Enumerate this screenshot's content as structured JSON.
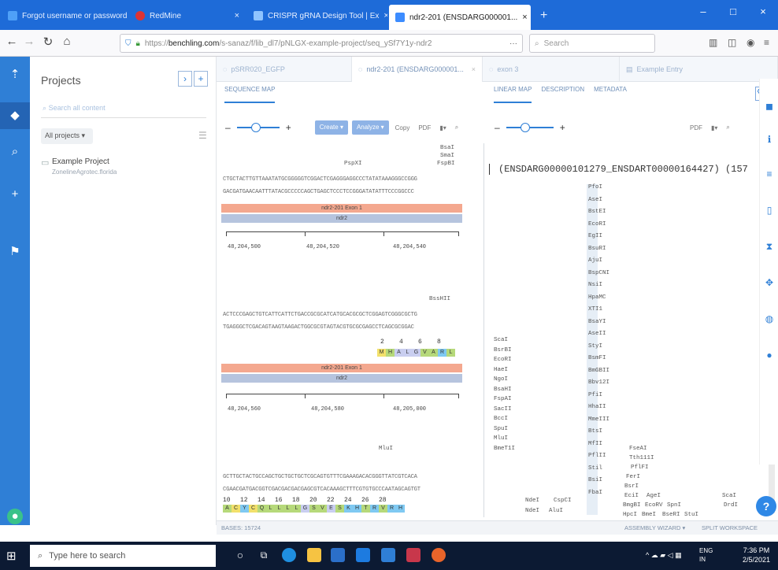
{
  "browser": {
    "tabs": [
      {
        "label": "Forgot username or password",
        "color": "#4fa0f7"
      },
      {
        "label": "RedMine",
        "color": "#d33"
      },
      {
        "label": "CRISPR gRNA Design Tool | Ex",
        "color": "#1e6bd8"
      },
      {
        "label": "ndr2-201 (ENSDARG000001...",
        "color": "#3c8cff"
      }
    ],
    "new_tab": "+",
    "window_controls": [
      "–",
      "□",
      "×"
    ],
    "url_prefix": "https://",
    "url_domain": "benchling.com",
    "url_rest": "/s-sanaz/f/lib_dl7/pNLGX-example-project/seq_ySf7Y1y-ndr2",
    "url_more": "···",
    "search_placeholder": "Search"
  },
  "rail": {
    "icons": [
      "pin",
      "box",
      "search",
      "plus",
      "flag"
    ]
  },
  "projects": {
    "title": "Projects",
    "collapse_btn": "›",
    "add_btn": "+",
    "search_placeholder": "Search all content",
    "filter": "All projects ▾",
    "items": [
      {
        "name": "Example Project",
        "subtitle": "ZonelineAgrotec.florida"
      }
    ]
  },
  "doc_tabs": [
    {
      "label": "pSRR020_EGFP"
    },
    {
      "label": "ndr2-201 (ENSDARG000001..."
    },
    {
      "label": "exon 3"
    },
    {
      "label": "Example Entry"
    }
  ],
  "left_panel": {
    "tab": "SEQUENCE MAP",
    "create_btn": "Create ▾",
    "analyze_btn": "Analyze ▾",
    "copy": "Copy",
    "pdf": "PDF",
    "blocks": [
      {
        "enzymes": [
          "BsaI",
          "SmaI",
          "PspXI",
          "FspBI"
        ],
        "top": "CTGCTACTTGTTAAATATGCGGGGGTCGGACTCGAGGGAGGCCCTATATAAAGGGCCGGG",
        "bottom": "GACGATGAACAATTTATACGCCCCCAGCTGAGCTCCCTCCGGGATATATTTCCCGGCCC",
        "feature": "ndr2-201 Exon 1",
        "gene": "ndr2",
        "ticks": [
          "48,204,500",
          "48,204,520",
          "48,204,540"
        ]
      },
      {
        "enzymes": [
          "BssHII"
        ],
        "top": "ACTCCCGAGCTGTCATTCATTCTGACCGCGCATCATGCACGCGCTCGGAGTCGGGCGCTG",
        "bottom": "TGAGGGCTCGACAGTAAGTAAGACTGGCGCGTAGTACGTGCGCGAGCCTCAGCGCGGAC",
        "aa_numbers": [
          "2",
          "4",
          "6",
          "8"
        ],
        "aa": [
          "M",
          "H",
          "A",
          "L",
          "G",
          "V",
          "A",
          "R",
          "L"
        ],
        "aa_colors": [
          "#f2e06b",
          "#b6d97a",
          "#c9cef0",
          "#c9cef0",
          "#c9cef0",
          "#b6d97a",
          "#b6d97a",
          "#7fc9f2",
          "#b6d97a"
        ],
        "feature": "ndr2-201 Exon 1",
        "gene": "ndr2",
        "ticks": [
          "48,204,560",
          "48,204,580",
          "48,205,000"
        ]
      },
      {
        "enzymes": [
          "MluI"
        ],
        "top": "GCTTGCTACTGCCAGCTGCTGCTGCTCGCAGTGTTTCGAAAGACACGGGTTATCGTCACA",
        "bottom": "CGAACGATGACGGTCGACGACGACGAGCGTCACAAAGCTTTCGTGTGCCCAATAGCAGTGT",
        "aa_numbers": [
          "10",
          "12",
          "14",
          "16",
          "18",
          "20",
          "22",
          "24",
          "26",
          "28"
        ],
        "aa": [
          "A",
          "C",
          "Y",
          "C",
          "Q",
          "L",
          "L",
          "L",
          "L",
          "G",
          "S",
          "V",
          "E",
          "S",
          "K",
          "H",
          "T",
          "R",
          "V",
          "R",
          "H"
        ],
        "aa_colors": [
          "#b6d97a",
          "#f2e06b",
          "#7fc9f2",
          "#f2e06b",
          "#b6d97a",
          "#b6d97a",
          "#b6d97a",
          "#b6d97a",
          "#b6d97a",
          "#c9cef0",
          "#b6d97a",
          "#b6d97a",
          "#c9cef0",
          "#b6d97a",
          "#7fc9f2",
          "#7fc9f2",
          "#b6d97a",
          "#7fc9f2",
          "#b6d97a",
          "#7fc9f2",
          "#7fc9f2"
        ]
      }
    ],
    "status": "BASES: 15724"
  },
  "right_panel": {
    "tabs": [
      "LINEAR MAP",
      "DESCRIPTION",
      "METADATA"
    ],
    "pdf": "PDF",
    "title": "(ENSDARG00000101279_ENSDART00000164427) (157",
    "center_enzymes": [
      "PfoI",
      "AseI",
      "BstEI",
      "EcoRI",
      "EgII",
      "BsuRI",
      "AjuI",
      "BspCNI",
      "NsiI",
      "HpaMC",
      "XTI1",
      "BsaYI",
      "AseII",
      "StyI",
      "BsmFI",
      "BmGBII",
      "Bbv12I",
      "PfiI",
      "HhaII",
      "MmeIII",
      "BtsI",
      "MfII",
      "PflII",
      "Stil",
      "BsiI",
      "FbaI"
    ],
    "left_enzymes": [
      "ScaI",
      "BsrBI",
      "EcoRI",
      "HaeI",
      "NgoI",
      "BsaHI",
      "FspAI",
      "SacII",
      "BccI",
      "SpuI",
      "MluI",
      "BmeT1I"
    ],
    "bottom_row1": [
      "NdeI",
      "CspCI",
      "AgeI",
      "ScaI"
    ],
    "bottom_row2": [
      "NdeI",
      "AluI",
      "EcoRV",
      "SpnI",
      "DrdI"
    ],
    "right_cluster": [
      "FseAI",
      "Tth111I",
      "PflFI",
      "FerI",
      "BsrI",
      "EciI",
      "BmgBI",
      "HpcI",
      "BmeI",
      "BseRI",
      "StuI"
    ],
    "footer_assembly": "ASSEMBLY WIZARD ▾",
    "footer_split": "SPLIT WORKSPACE"
  },
  "taskbar": {
    "search_placeholder": "Type here to search",
    "lang": "ENG",
    "lang2": "IN",
    "time": "7:36 PM",
    "date": "2/5/2021"
  },
  "help": "?"
}
